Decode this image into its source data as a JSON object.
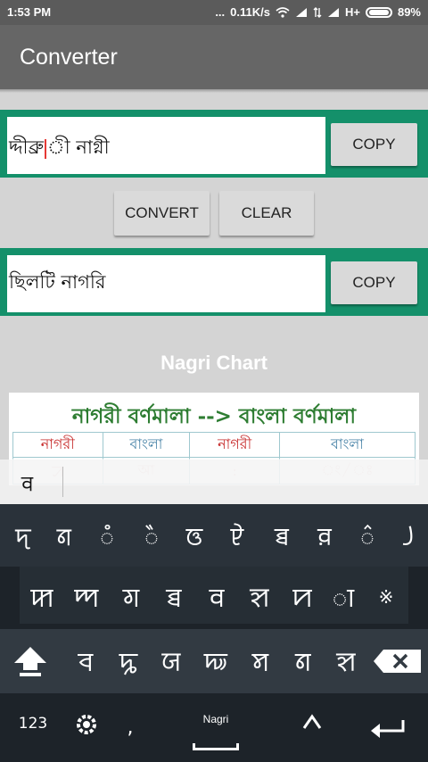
{
  "status_bar": {
    "time": "1:53 PM",
    "dots": "...",
    "speed": "0.11K/s",
    "network": "H+",
    "battery": "89%"
  },
  "app": {
    "title": "Converter"
  },
  "input": {
    "text_before_cursor": "দ্দীব্রু",
    "text_after_cursor": "ী নাগ্নী",
    "copy_label": "COPY"
  },
  "actions": {
    "convert_label": "CONVERT",
    "clear_label": "CLEAR"
  },
  "output": {
    "text": "ছিলটি নাগরি",
    "copy_label": "COPY"
  },
  "chart": {
    "title": "Nagri Chart",
    "heading": "নাগরী বর্ণমালা --> বাংলা বর্ণমালা",
    "columns": [
      "নাগরী",
      "বাংলা",
      "নাগরী",
      "বাংলা"
    ],
    "faded_row": [
      "ꠀ",
      "আ",
      ":",
      "ং/ঃ"
    ]
  },
  "suggestion": {
    "word": "ꠛ"
  },
  "keyboard": {
    "row1": [
      "ꠖ",
      "ꠘ",
      "ꠋ",
      "ꠂ",
      "ꠃ",
      "ꠄ",
      "ꠊ",
      "ꠅ",
      "꠆",
      "꠸"
    ],
    "row2": [
      "ꠇ",
      "ꠈ",
      "ꠉ",
      "ꠊ",
      "ꠛ",
      "ꠡ",
      "ꠙ",
      "ꠣ",
      "※"
    ],
    "row3": [
      "ꠌ",
      "ꠍ",
      "ꠎ",
      "ꠏ",
      "ꠝ",
      "ꠘ",
      "ꠡ"
    ],
    "numbers_label": "123",
    "comma_label": ",",
    "space_label": "Nagri"
  },
  "colors": {
    "accent": "#14906a",
    "appbar": "#666666",
    "keyboard": "#1d2329"
  }
}
